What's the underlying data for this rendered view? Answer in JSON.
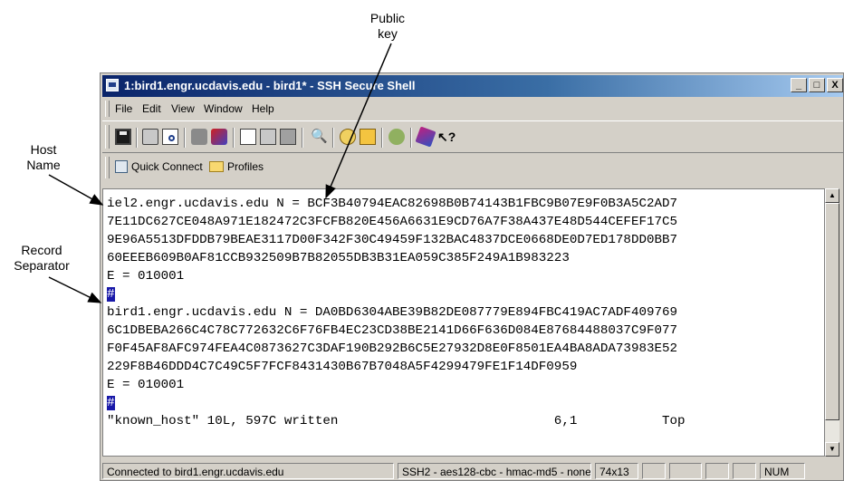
{
  "annotations": {
    "public_key": [
      "Public",
      "key"
    ],
    "host_name": [
      "Host",
      "Name"
    ],
    "record_separator": [
      "Record",
      "Separator"
    ]
  },
  "window": {
    "title": "1:bird1.engr.ucdavis.edu - bird1* - SSH Secure Shell",
    "controls": [
      "_",
      "□",
      "X"
    ]
  },
  "menu": [
    "File",
    "Edit",
    "View",
    "Window",
    "Help"
  ],
  "toolbar_icons": [
    "save-icon",
    "print-icon",
    "print-preview-icon",
    "disconnect-icon",
    "settings-icon",
    "copy-icon",
    "paste-icon",
    "paste-special-icon",
    "find-icon",
    "new-terminal-icon",
    "file-transfer-icon",
    "config-icon",
    "help-icon",
    "context-help-icon"
  ],
  "quickbar": {
    "quick_connect": "Quick Connect",
    "profiles": "Profiles"
  },
  "terminal": {
    "lines": [
      {
        "text": "iel2.engr.ucdavis.edu N = BCF3B40794EAC82698B0B74143B1FBC9B07E9F0B3A5C2AD7"
      },
      {
        "text": "7E11DC627CE048A971E182472C3FCFB820E456A6631E9CD76A7F38A437E48D544CEFEF17C5"
      },
      {
        "text": "9E96A5513DFDDB79BEAE3117D00F342F30C49459F132BAC4837DCE0668DE0D7ED178DD0BB7"
      },
      {
        "text": "60EEEB609B0AF81CCB932509B7B82055DB3B31EA059C385F249A1B983223"
      },
      {
        "text": "E = 010001"
      },
      {
        "text": "#",
        "hl": true
      },
      {
        "text": "bird1.engr.ucdavis.edu N = DA0BD6304ABE39B82DE087779E894FBC419AC7ADF409769"
      },
      {
        "text": "6C1DBEBA266C4C78C772632C6F76FB4EC23CD38BE2141D66F636D084E87684488037C9F077"
      },
      {
        "text": "F0F45AF8AFC974FEA4C0873627C3DAF190B292B6C5E27932D8E0F8501EA4BA8ADA73983E52"
      },
      {
        "text": "229F8B46DDD4C7C49C5F7FCF8431430B67B7048A5F4299479FE1F14DF0959"
      },
      {
        "text": "E = 010001"
      },
      {
        "text": "#",
        "hl": true
      },
      {
        "text": "\"known_host\" 10L, 597C written                            6,1           Top"
      }
    ]
  },
  "status": {
    "connection": "Connected to bird1.engr.ucdavis.edu",
    "cipher": "SSH2 - aes128-cbc - hmac-md5 - none",
    "size": "74x13",
    "mode": "NUM"
  }
}
